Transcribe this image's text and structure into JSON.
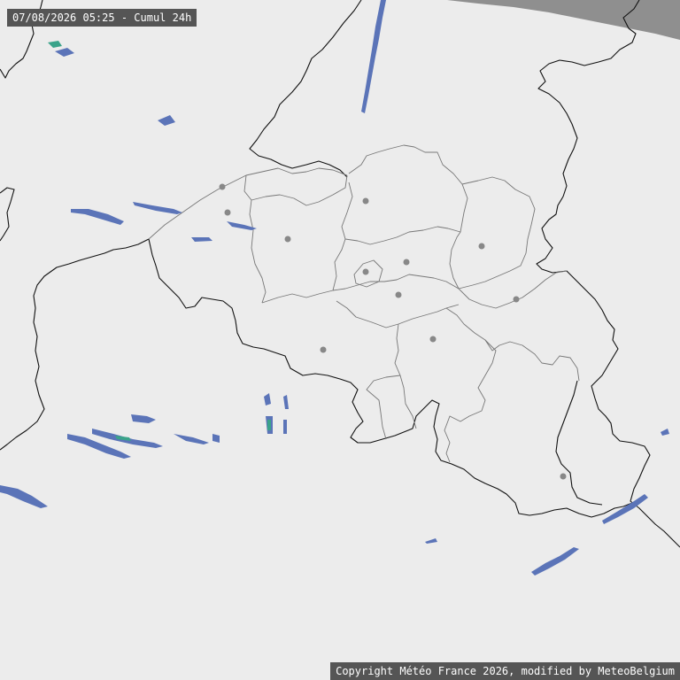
{
  "header": {
    "timestamp_label": "07/08/2026 05:25 - Cumul 24h"
  },
  "footer": {
    "copyright": "Copyright Météo France 2026, modified by MeteoBelgium"
  },
  "colors": {
    "background": "#ececec",
    "sea": "#8f8f8f",
    "border": "#111111",
    "province": "#777777",
    "city": "#888888",
    "precip_light": "#5b74b8",
    "precip_medium": "#3aa38a"
  },
  "map": {
    "product": "Cumul 24h",
    "layers": [
      "country-borders",
      "province-borders",
      "coastline",
      "city-markers",
      "precipitation-echoes"
    ]
  }
}
